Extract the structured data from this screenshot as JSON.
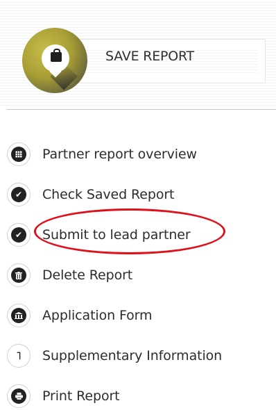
{
  "save": {
    "label": "SAVE REPORT",
    "icon": "bag-icon",
    "accent": "#a79d35"
  },
  "menu": {
    "items": [
      {
        "label": "Partner report overview",
        "icon": "table-icon"
      },
      {
        "label": "Check Saved Report",
        "icon": "check-icon"
      },
      {
        "label": "Submit to lead partner",
        "icon": "check-icon"
      },
      {
        "label": "Delete Report",
        "icon": "trash-icon"
      },
      {
        "label": "Application Form",
        "icon": "building-icon"
      },
      {
        "label": "Supplementary Information",
        "icon": "corner-arrow-icon"
      },
      {
        "label": "Print Report",
        "icon": "printer-icon"
      }
    ]
  },
  "annotation": {
    "color": "#e0101a",
    "target": "Submit to lead partner"
  }
}
